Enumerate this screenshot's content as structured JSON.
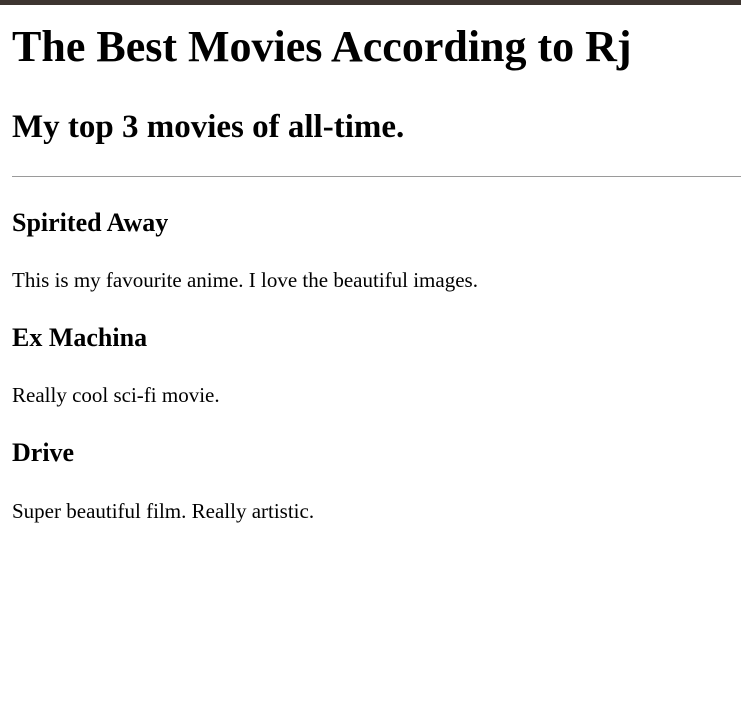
{
  "page": {
    "title": "The Best Movies According to Rj",
    "subtitle": "My top 3 movies of all-time.",
    "accent_bar_color": "#3d3530"
  },
  "movies": [
    {
      "title": "Spirited Away",
      "description": "This is my favourite anime. I love the beautiful images."
    },
    {
      "title": "Ex Machina",
      "description": "Really cool sci-fi movie."
    },
    {
      "title": "Drive",
      "description": "Super beautiful film. Really artistic."
    }
  ]
}
